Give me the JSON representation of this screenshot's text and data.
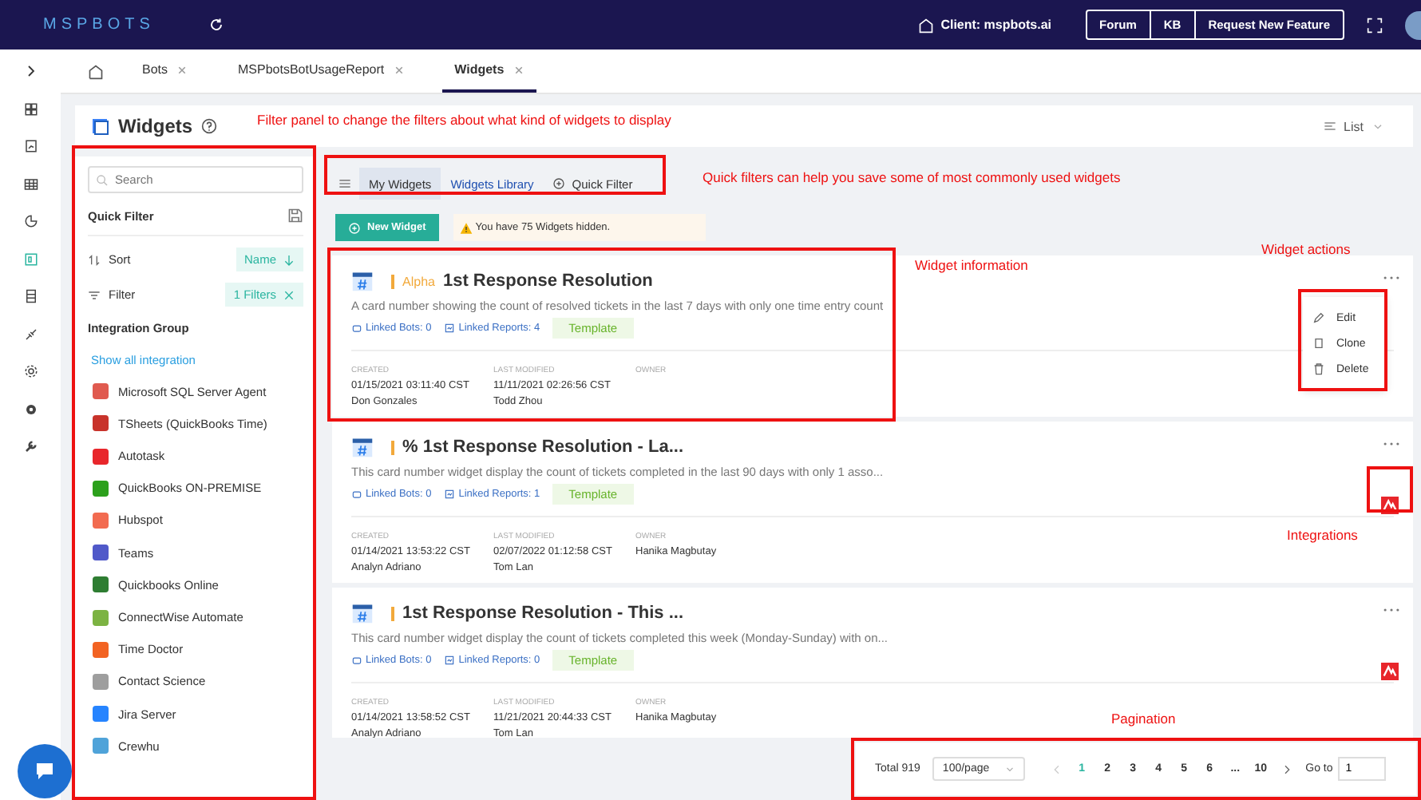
{
  "topbar": {
    "logo": "MSPBOTS",
    "client": "Client: mspbots.ai",
    "links": [
      "Forum",
      "KB",
      "Request New Feature"
    ]
  },
  "rail": {
    "items": [
      {
        "kind": "grid",
        "selected": false
      },
      {
        "kind": "report",
        "selected": false
      },
      {
        "kind": "table",
        "selected": false
      },
      {
        "kind": "chart",
        "selected": false
      },
      {
        "kind": "widget",
        "selected": true
      },
      {
        "kind": "list",
        "selected": false
      },
      {
        "kind": "link",
        "selected": false
      },
      {
        "kind": "gear",
        "selected": false
      },
      {
        "kind": "cog",
        "selected": false
      },
      {
        "kind": "wrench",
        "selected": false
      }
    ]
  },
  "tabs": [
    {
      "label": "Bots",
      "selected": false
    },
    {
      "label": "MSPbotsBotUsageReport",
      "selected": false
    },
    {
      "label": "Widgets",
      "selected": true
    }
  ],
  "header": {
    "title": "Widgets",
    "view": "List"
  },
  "filter_panel": {
    "search_placeholder": "Search",
    "quick_filter": "Quick Filter",
    "sort_label": "Sort",
    "sort_value": "Name",
    "filter_label": "Filter",
    "filter_value": "1 Filters",
    "group_title": "Integration Group",
    "show_all": "Show all integration",
    "integrations": [
      {
        "name": "Microsoft SQL Server Agent",
        "color": "#e05a4f"
      },
      {
        "name": "TSheets (QuickBooks Time)",
        "color": "#c8332b"
      },
      {
        "name": "Autotask",
        "color": "#e8262b"
      },
      {
        "name": "QuickBooks ON-PREMISE",
        "color": "#2ca01c"
      },
      {
        "name": "Hubspot",
        "color": "#f26b50"
      },
      {
        "name": "Teams",
        "color": "#5059c9"
      },
      {
        "name": "Quickbooks Online",
        "color": "#2e7d32"
      },
      {
        "name": "ConnectWise Automate",
        "color": "#7cb342"
      },
      {
        "name": "Time Doctor",
        "color": "#f26322"
      },
      {
        "name": "Contact Science",
        "color": "#9e9e9e"
      },
      {
        "name": "Jira Server",
        "color": "#2684ff"
      },
      {
        "name": "Crewhu",
        "color": "#4fa3d9"
      }
    ]
  },
  "view_tabs": [
    {
      "label": "My Widgets",
      "selected": true,
      "kind": "tab"
    },
    {
      "label": "Widgets Library",
      "selected": false,
      "kind": "tab"
    },
    {
      "label": "Quick Filter",
      "selected": false,
      "kind": "add"
    }
  ],
  "new_widget": "New Widget",
  "hidden_notice": "You have 75 Widgets hidden.",
  "cards": [
    {
      "tag": "Alpha",
      "title": "1st Response Resolution",
      "description": "A card number showing the count of resolved tickets in the last 7 days with only one time entry count",
      "linked_bots": "Linked Bots: 0",
      "linked_reports": "Linked Reports: 4",
      "badge": "Template",
      "labels": [
        "CREATED",
        "LAST MODIFIED",
        "OWNER"
      ],
      "created": "01/15/2021 03:11:40 CST",
      "created_by": "Don Gonzales",
      "modified": "11/11/2021 02:26:56 CST",
      "modified_by": "Todd Zhou",
      "has_integration": false,
      "menu": [
        {
          "label": "Edit",
          "kind": "edit"
        },
        {
          "label": "Clone",
          "kind": "clone"
        },
        {
          "label": "Delete",
          "kind": "delete"
        }
      ]
    },
    {
      "title": "% 1st Response Resolution - La...",
      "description": "This card number widget display the count of tickets completed in the last 90 days with only 1 asso...",
      "linked_bots": "Linked Bots: 0",
      "linked_reports": "Linked Reports: 1",
      "badge": "Template",
      "labels": [
        "CREATED",
        "LAST MODIFIED",
        "OWNER"
      ],
      "created": "01/14/2021 13:53:22 CST",
      "created_by": "Analyn Adriano",
      "modified": "02/07/2022 01:12:58 CST",
      "modified_by": "Tom Lan",
      "owner": "Hanika Magbutay",
      "has_integration": true
    },
    {
      "title": "1st Response Resolution - This ...",
      "description": "This card number widget display the count of tickets completed this week (Monday-Sunday) with on...",
      "linked_bots": "Linked Bots: 0",
      "linked_reports": "Linked Reports: 0",
      "badge": "Template",
      "labels": [
        "CREATED",
        "LAST MODIFIED",
        "OWNER"
      ],
      "created": "01/14/2021 13:58:52 CST",
      "created_by": "Analyn Adriano",
      "modified": "11/21/2021 20:44:33 CST",
      "modified_by": "Tom Lan",
      "owner": "Hanika Magbutay",
      "has_integration": true
    }
  ],
  "pagination": {
    "total": "Total 919",
    "page_size": "100/page",
    "pages": [
      {
        "label": "1",
        "selected": true
      },
      {
        "label": "2",
        "selected": false
      },
      {
        "label": "3",
        "selected": false
      },
      {
        "label": "4",
        "selected": false
      },
      {
        "label": "5",
        "selected": false
      },
      {
        "label": "6",
        "selected": false
      },
      {
        "label": "...",
        "selected": false
      },
      {
        "label": "10",
        "selected": false
      }
    ],
    "goto_label": "Go to",
    "goto_value": "1"
  },
  "annotations": [
    "Filter panel to change the filters about what kind of widgets to display",
    "Quick filters can help you save some of most commonly used widgets",
    "Widget information",
    "Widget actions",
    "Integrations",
    "Pagination"
  ]
}
